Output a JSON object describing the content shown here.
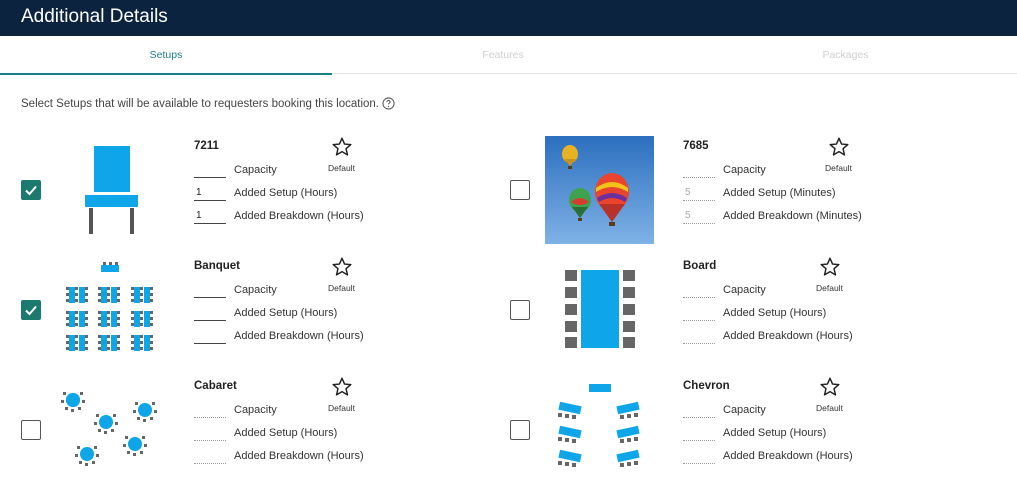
{
  "header": {
    "title": "Additional Details"
  },
  "tabs": [
    {
      "label": "Setups",
      "active": true
    },
    {
      "label": "Features",
      "active": false
    },
    {
      "label": "Packages",
      "active": false
    }
  ],
  "intro": "Select Setups that will be available to requesters booking this location.",
  "help_icon": "question-circle-icon",
  "star_icon": "star-outline-icon",
  "default_label": "Default",
  "accent_color": "#1a7f86",
  "checkbox_color": "#1a7a6e",
  "header_color": "#0c2340",
  "setups": [
    {
      "name": "7211",
      "checked": true,
      "image": "chair-icon",
      "fields": [
        {
          "value": "",
          "label": "Capacity"
        },
        {
          "value": "1",
          "label": "Added Setup (Hours)"
        },
        {
          "value": "1",
          "label": "Added Breakdown (Hours)"
        }
      ]
    },
    {
      "name": "7685",
      "checked": false,
      "image": "hot-air-balloons-photo",
      "fields": [
        {
          "value": "",
          "label": "Capacity"
        },
        {
          "value": "5",
          "label": "Added Setup (Minutes)"
        },
        {
          "value": "5",
          "label": "Added Breakdown (Minutes)"
        }
      ]
    },
    {
      "name": "Banquet",
      "checked": true,
      "image": "banquet-layout-icon",
      "fields": [
        {
          "value": "",
          "label": "Capacity"
        },
        {
          "value": "",
          "label": "Added Setup (Hours)"
        },
        {
          "value": "",
          "label": "Added Breakdown (Hours)"
        }
      ]
    },
    {
      "name": "Board",
      "checked": false,
      "image": "board-layout-icon",
      "fields": [
        {
          "value": "",
          "label": "Capacity"
        },
        {
          "value": "",
          "label": "Added Setup (Hours)"
        },
        {
          "value": "",
          "label": "Added Breakdown (Hours)"
        }
      ]
    },
    {
      "name": "Cabaret",
      "checked": false,
      "image": "cabaret-layout-icon",
      "fields": [
        {
          "value": "",
          "label": "Capacity"
        },
        {
          "value": "",
          "label": "Added Setup (Hours)"
        },
        {
          "value": "",
          "label": "Added Breakdown (Hours)"
        }
      ]
    },
    {
      "name": "Chevron",
      "checked": false,
      "image": "chevron-layout-icon",
      "fields": [
        {
          "value": "",
          "label": "Capacity"
        },
        {
          "value": "",
          "label": "Added Setup (Hours)"
        },
        {
          "value": "",
          "label": "Added Breakdown (Hours)"
        }
      ]
    }
  ]
}
